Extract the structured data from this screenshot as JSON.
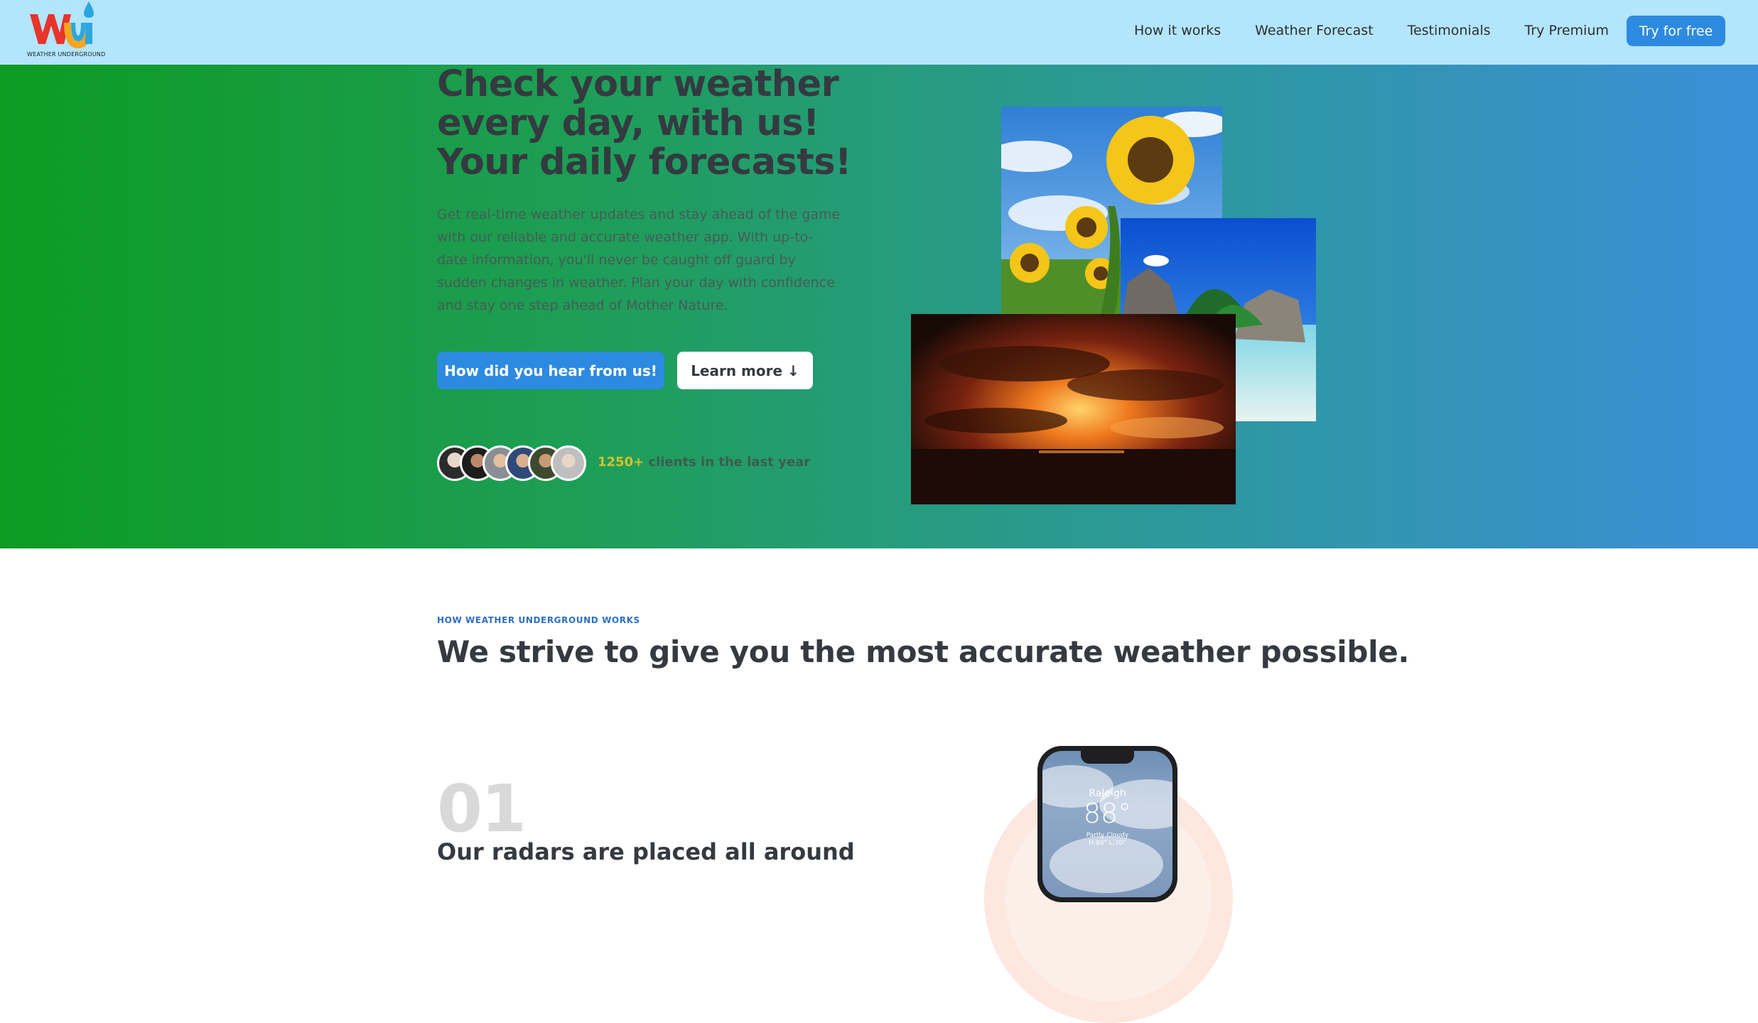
{
  "nav": {
    "logo_text": "WEATHER UNDERGROUND",
    "links": [
      "How it works",
      "Weather Forecast",
      "Testimonials",
      "Try Premium"
    ],
    "cta": "Try for free"
  },
  "hero": {
    "title_lines": [
      "Check your weather",
      "every day, with us!",
      "Your daily forecasts!"
    ],
    "description": "Get real-time weather updates and stay ahead of the game with our reliable and accurate weather app. With up-to-date information, you'll never be caught off guard by sudden changes in weather. Plan your day with confidence and stay one step ahead of Mother Nature.",
    "primary_button": "How did you hear from us!",
    "secondary_button": "Learn more ↓",
    "clients_count": "1250+",
    "clients_text": "clients in the last year"
  },
  "how_it_works": {
    "subheading": "HOW WEATHER UNDERGROUND WORKS",
    "title": "We strive to give you the most accurate weather possible.",
    "step_number": "01",
    "step_title": "Our radars are placed all around"
  },
  "phone": {
    "city": "Raleigh",
    "temperature": "88°",
    "condition": "Partly Cloudy",
    "high_low": "H:89° L:70°"
  },
  "colors": {
    "nav_bg": "#b3e5fc",
    "accent": "#2d8ae0",
    "hero_gradient_start": "#0d9b22",
    "hero_gradient_end": "#3b8fd8",
    "clients_highlight": "#d4c22a"
  }
}
